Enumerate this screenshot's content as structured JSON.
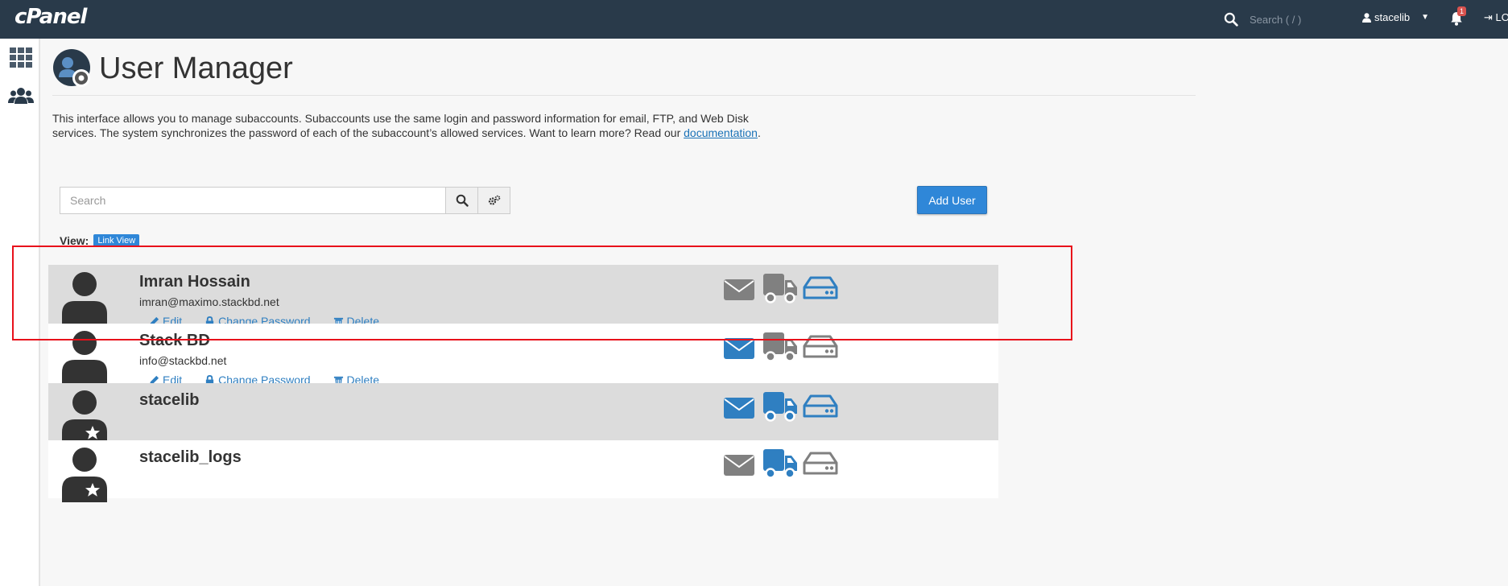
{
  "colors": {
    "navbar": "#293a4a",
    "accent": "#2f87d8",
    "link": "#2f7fc1",
    "service_on": "#2f7fc1",
    "service_off": "#808080",
    "highlight": "#e8111b"
  },
  "header": {
    "logo": "cPanel",
    "search_placeholder": "Search ( / )",
    "username": "stacelib",
    "notifications_count": "1",
    "logout_label": "LOGOUT"
  },
  "sidebar": {
    "items": [
      {
        "icon": "apps-grid-icon"
      },
      {
        "icon": "users-icon"
      }
    ]
  },
  "page": {
    "title": "User Manager",
    "description_text": "This interface allows you to manage subaccounts. Subaccounts use the same login and password information for email, FTP, and Web Disk services. The system synchronizes the password of each of the subaccount’s allowed services. Want to learn more? Read our ",
    "description_link": "documentation",
    "description_end": "."
  },
  "toolbar": {
    "search_placeholder": "Search",
    "add_user_label": "Add User",
    "view_label": "View:",
    "view_mode": "Link View"
  },
  "actions": {
    "edit": "Edit",
    "change_password": "Change Password",
    "delete": "Delete"
  },
  "users": [
    {
      "name": "Imran Hossain",
      "email": "imran@maximo.stackbd.net",
      "type": "subaccount",
      "services": {
        "email": false,
        "ftp": false,
        "webdisk": true
      }
    },
    {
      "name": "Stack BD",
      "email": "info@stackbd.net",
      "type": "subaccount",
      "services": {
        "email": true,
        "ftp": false,
        "webdisk": false
      }
    },
    {
      "name": "stacelib",
      "email": "",
      "type": "owner",
      "services": {
        "email": true,
        "ftp": true,
        "webdisk": true
      }
    },
    {
      "name": "stacelib_logs",
      "email": "",
      "type": "owner",
      "services": {
        "email": false,
        "ftp": true,
        "webdisk": false
      }
    }
  ]
}
